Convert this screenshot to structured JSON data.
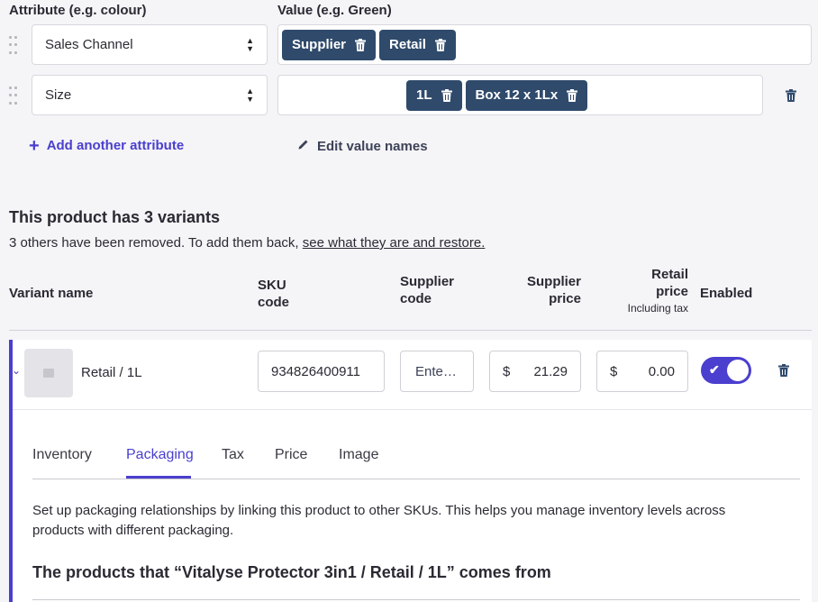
{
  "headers": {
    "attribute": "Attribute (e.g. colour)",
    "value": "Value (e.g. Green)"
  },
  "attributes": [
    {
      "name": "Sales Channel",
      "values": [
        "Supplier",
        "Retail"
      ]
    },
    {
      "name": "Size",
      "values": [
        "1L",
        "Box 12 x 1Lx"
      ]
    }
  ],
  "actions": {
    "add_attribute": "Add another attribute",
    "edit_values": "Edit value names"
  },
  "variants": {
    "title": "This product has 3 variants",
    "removed_text": "3 others have been removed. To add them back, ",
    "restore_link": "see what they are and restore."
  },
  "table": {
    "col_variant": "Variant name",
    "col_sku_1": "SKU",
    "col_sku_2": "code",
    "col_supplier_code_1": "Supplier",
    "col_supplier_code_2": "code",
    "col_supplier_price_1": "Supplier",
    "col_supplier_price_2": "price",
    "col_retail_1": "Retail",
    "col_retail_2": "price",
    "col_retail_note": "Including tax",
    "col_enabled": "Enabled"
  },
  "row": {
    "name": "Retail / 1L",
    "sku": "934826400911",
    "supplier_code_placeholder": "Enter supplier code",
    "currency": "$",
    "supplier_price": "21.29",
    "retail_price": "0.00",
    "enabled": true
  },
  "tabs": [
    "Inventory",
    "Packaging",
    "Tax",
    "Price",
    "Image"
  ],
  "active_tab": "Packaging",
  "packaging": {
    "description": "Set up packaging relationships by linking this product to other SKUs. This helps you manage inventory levels across products with different packaging.",
    "heading": "The products that “Vitalyse Protector 3in1 / Retail / 1L” comes from"
  },
  "colors": {
    "accent": "#4a3fce",
    "chip": "#2f4a6b"
  }
}
